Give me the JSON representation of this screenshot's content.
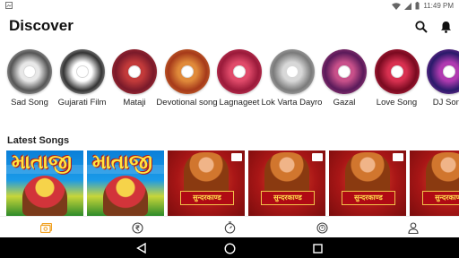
{
  "status_bar": {
    "time": "11:49 PM"
  },
  "header": {
    "title": "Discover"
  },
  "categories": [
    {
      "label": "Sad Song",
      "colors": [
        "#e8e8e8",
        "#555555"
      ]
    },
    {
      "label": "Gujarati Film",
      "colors": [
        "#ffffff",
        "#333333"
      ]
    },
    {
      "label": "Mataji",
      "colors": [
        "#c23a3a",
        "#7a1a2a"
      ]
    },
    {
      "label": "Devotional song",
      "colors": [
        "#e08a3a",
        "#a63a1a"
      ]
    },
    {
      "label": "Lagnageet",
      "colors": [
        "#e04a6a",
        "#9a1a3a"
      ]
    },
    {
      "label": "Lok Varta Dayro",
      "colors": [
        "#d8d8d8",
        "#7a7a7a"
      ]
    },
    {
      "label": "Gazal",
      "colors": [
        "#c8508a",
        "#5a1a5a"
      ]
    },
    {
      "label": "Love Song",
      "colors": [
        "#d83050",
        "#7a0a20"
      ]
    },
    {
      "label": "DJ Song",
      "colors": [
        "#b03ab0",
        "#2a1a6a"
      ]
    }
  ],
  "latest": {
    "title": "Latest Songs",
    "songs": [
      {
        "type": "mataji",
        "title": "માતાજી"
      },
      {
        "type": "mataji",
        "title": "માતાજી"
      },
      {
        "type": "hanuman",
        "title": "सुन्दरकाण्ड"
      },
      {
        "type": "hanuman",
        "title": "सुन्दरकाण्ड"
      },
      {
        "type": "hanuman",
        "title": "सुन्दरकाण्ड"
      },
      {
        "type": "hanuman",
        "title": "सुन्दरकाण्ड"
      }
    ]
  },
  "bottom_nav": {
    "items": [
      {
        "name": "library-icon",
        "active": true
      },
      {
        "name": "rupee-icon",
        "active": false
      },
      {
        "name": "timer-icon",
        "active": false
      },
      {
        "name": "coin-icon",
        "active": false
      },
      {
        "name": "profile-icon",
        "active": false
      }
    ],
    "accent": "#f0a020"
  }
}
